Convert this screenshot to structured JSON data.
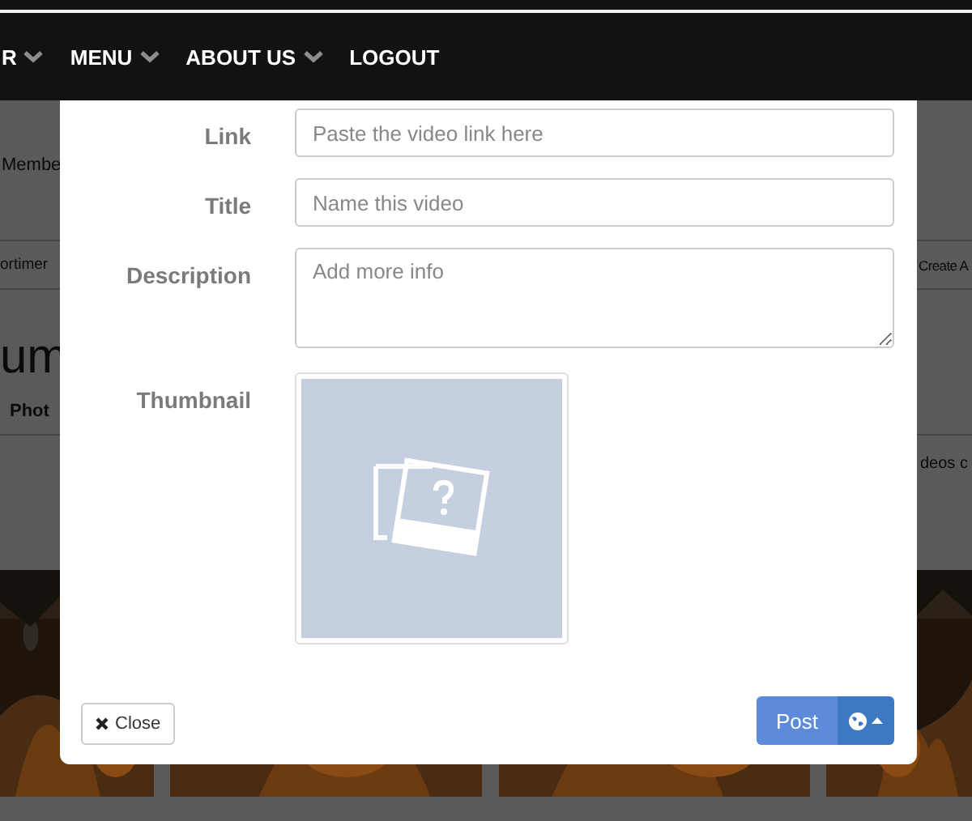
{
  "nav": {
    "items": [
      {
        "label": "R",
        "has_menu": true
      },
      {
        "label": "MENU",
        "has_menu": true
      },
      {
        "label": "ABOUT US",
        "has_menu": true
      },
      {
        "label": "LOGOUT",
        "has_menu": false
      }
    ]
  },
  "background": {
    "member_text": "Membe",
    "row_left": "ortimer",
    "row_right": "Create A",
    "heading": "um",
    "tab": "Phot",
    "side_text": "deos c"
  },
  "modal": {
    "fields": [
      {
        "label": "Link",
        "kind": "input",
        "placeholder": "Paste the video link here"
      },
      {
        "label": "Title",
        "kind": "input",
        "placeholder": "Name this video"
      },
      {
        "label": "Description",
        "kind": "textarea",
        "placeholder": "Add more info"
      },
      {
        "label": "Thumbnail",
        "kind": "thumbnail"
      }
    ],
    "close_button": "Close",
    "post_button": "Post"
  }
}
